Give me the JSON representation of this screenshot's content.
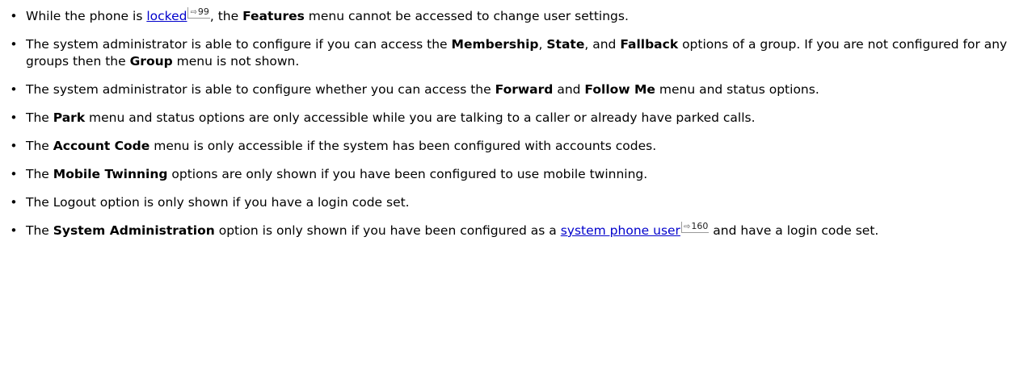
{
  "bullet_char": "•",
  "items": [
    {
      "t1": "While the phone is ",
      "link": "locked",
      "link_page": "99",
      "t2": ", the ",
      "b1": "Features",
      "t3": " menu cannot be accessed to change user settings."
    },
    {
      "t1": "The system administrator is able to configure if you can access the ",
      "b1": "Membership",
      "t2": ", ",
      "b2": "State",
      "t3": ", and ",
      "b3": "Fallback",
      "t4": " options of a group. If you are not configured for any groups then the ",
      "b4": "Group",
      "t5": " menu is not shown."
    },
    {
      "t1": "The system administrator is able to configure whether you can access the ",
      "b1": "Forward",
      "t2": " and ",
      "b2": "Follow Me",
      "t3": " menu and status options."
    },
    {
      "t1": "The ",
      "b1": "Park",
      "t2": " menu and status options are only accessible while you are talking to a caller or already have parked calls."
    },
    {
      "t1": "The ",
      "b1": "Account Code",
      "t2": " menu is only accessible if the system has been configured with accounts codes."
    },
    {
      "t1": "The ",
      "b1": "Mobile Twinning",
      "t2": " options are only shown if you have been configured to use mobile twinning."
    },
    {
      "t1": "The Logout option is only shown if you have a login code set."
    },
    {
      "t1": "The ",
      "b1": "System Administration",
      "t2": " option is only shown if you have been configured as a ",
      "link": "system phone user",
      "link_page": "160",
      "t3": " and have a login code set."
    }
  ]
}
